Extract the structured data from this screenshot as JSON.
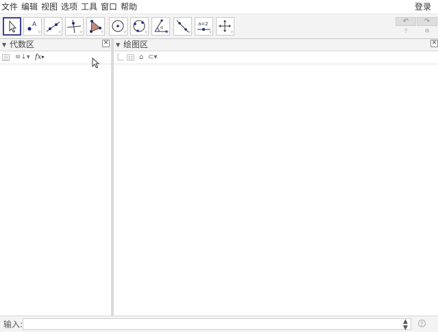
{
  "menubar": {
    "items": [
      "文件",
      "编辑",
      "视图",
      "选项",
      "工具",
      "窗口",
      "帮助"
    ],
    "login_label": "登录"
  },
  "toolbar": {
    "tools": [
      {
        "name": "move-tool-icon",
        "active": true
      },
      {
        "name": "point-tool-icon",
        "active": false
      },
      {
        "name": "line-tool-icon",
        "active": false
      },
      {
        "name": "perpendicular-tool-icon",
        "active": false
      },
      {
        "name": "polygon-tool-icon",
        "active": false
      },
      {
        "name": "circle-tool-icon",
        "active": false
      },
      {
        "name": "circle-three-points-tool-icon",
        "active": false
      },
      {
        "name": "angle-tool-icon",
        "active": false
      },
      {
        "name": "reflect-tool-icon",
        "active": false
      },
      {
        "name": "slider-tool-icon",
        "active": false
      },
      {
        "name": "move-graphics-tool-icon",
        "active": false
      }
    ],
    "slider_tool_text": "a=2",
    "undo_icon": "undo-icon",
    "redo_icon": "redo-icon",
    "help_icon": "help-icon",
    "settings_icon": "settings-icon"
  },
  "algebra_view": {
    "title": "代数区",
    "fx_label": "fx"
  },
  "graphics_view": {
    "title": "绘图区"
  },
  "input_bar": {
    "label": "输入:",
    "value": "",
    "placeholder": ""
  },
  "colors": {
    "accent": "#3a3f9b",
    "point_blue": "#1e2a80",
    "polygon_fill": "#c48a7a"
  }
}
